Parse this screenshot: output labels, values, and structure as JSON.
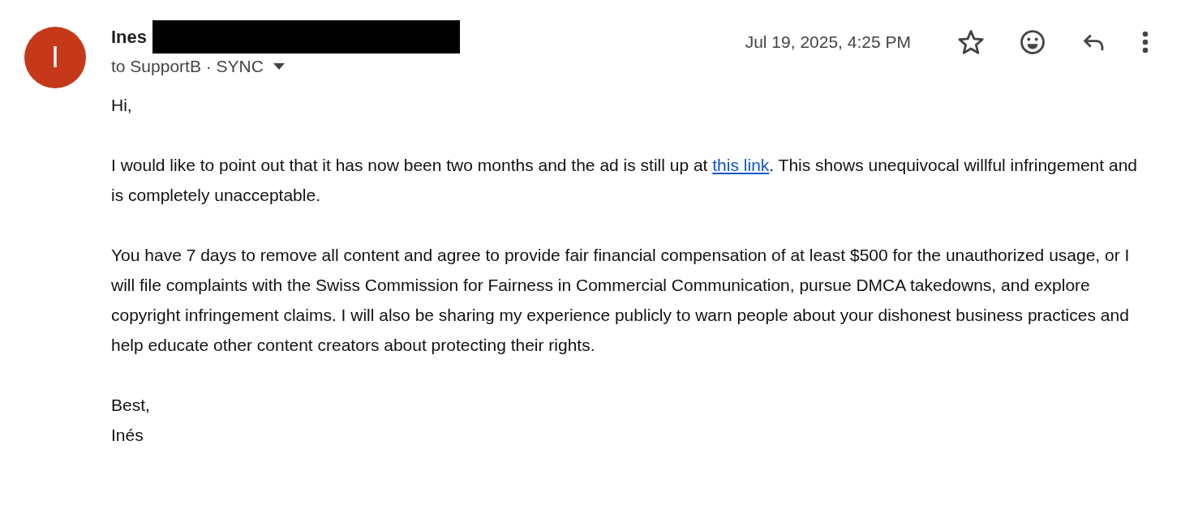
{
  "sender": {
    "initial": "I",
    "color": "#c5391a",
    "name": "Ines",
    "recipients": "to SupportB · SYNC"
  },
  "date": "Jul 19, 2025, 4:25 PM",
  "starred": false,
  "body": [
    {
      "text": "Hi,"
    },
    {
      "before": "I would like to point out that it has now been two months and the ad is still up at ",
      "link": "this link",
      "after": ". This shows unequivocal willful infringement and is completely unacceptable."
    },
    {
      "text": "You have 7 days to remove all content and agree to provide fair financial compensation of at least $500 for the unauthorized usage, or I will file complaints with the Swiss Commission for Fairness in Commercial Communication, pursue DMCA takedowns, and explore copyright infringement claims. I will also be sharing my experience publicly to warn people about your dishonest business practices and help educate other content creators about protecting their rights."
    }
  ],
  "signoff": [
    "Best,",
    "Inés"
  ]
}
